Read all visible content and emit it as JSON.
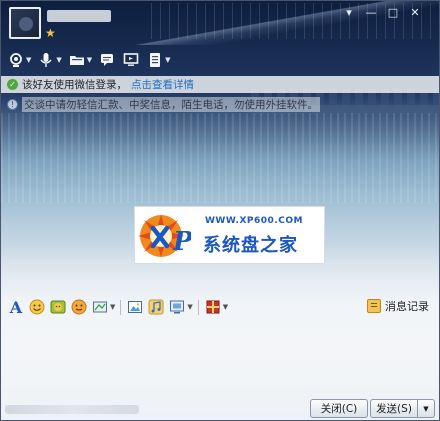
{
  "window": {
    "minimize_label": "—",
    "maximize_label": "□",
    "close_label": "✕",
    "settings_label": "▾"
  },
  "notices": {
    "wechat_login": "该好友使用微信登录，",
    "wechat_link": "点击查看详情",
    "security_tip": "交谈中请勿轻信汇款、中奖信息，陌生电话，勿使用外挂软件。"
  },
  "watermark": {
    "url": "WWW.XP600.COM",
    "title": "系统盘之家",
    "badge_letter": "P"
  },
  "input_toolbar": {
    "font_label": "A",
    "history_label": "消息记录"
  },
  "buttons": {
    "close": "关闭(C)",
    "send": "发送(S)",
    "send_options": "▼"
  }
}
